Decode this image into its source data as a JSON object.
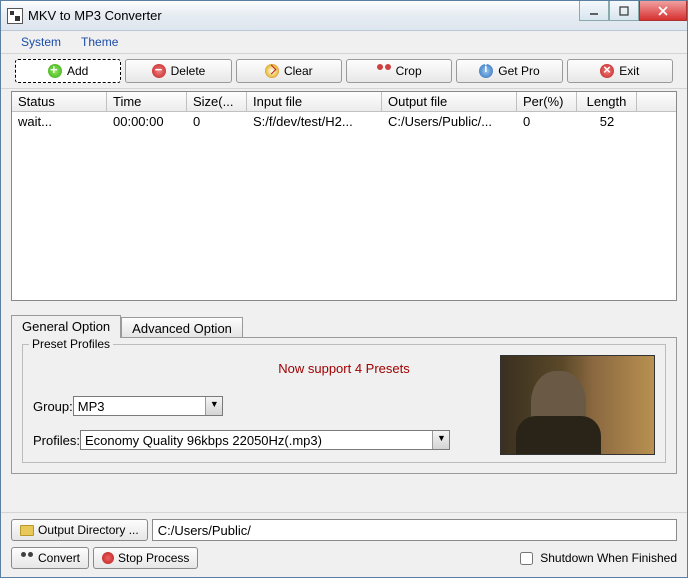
{
  "window": {
    "title": "MKV to MP3 Converter"
  },
  "menu": {
    "system": "System",
    "theme": "Theme"
  },
  "toolbar": {
    "add": "Add",
    "delete": "Delete",
    "clear": "Clear",
    "crop": "Crop",
    "getpro": "Get Pro",
    "exit": "Exit"
  },
  "grid": {
    "headers": {
      "status": "Status",
      "time": "Time",
      "size": "Size(...",
      "input": "Input file",
      "output": "Output file",
      "per": "Per(%)",
      "length": "Length"
    },
    "row0": {
      "status": "wait...",
      "time": "00:00:00",
      "size": "0",
      "input": "S:/f/dev/test/H2...",
      "output": "C:/Users/Public/...",
      "per": "0",
      "length": "52"
    }
  },
  "tabs": {
    "general": "General Option",
    "advanced": "Advanced Option"
  },
  "preset": {
    "legend": "Preset Profiles",
    "message": "Now support 4 Presets",
    "group_label": "Group:",
    "group_value": "MP3",
    "profiles_label": "Profiles:",
    "profiles_value": "Economy Quality 96kbps 22050Hz(.mp3)"
  },
  "output": {
    "button": "Output Directory ...",
    "path": "C:/Users/Public/"
  },
  "actions": {
    "convert": "Convert",
    "stop": "Stop Process",
    "shutdown": "Shutdown When Finished"
  }
}
